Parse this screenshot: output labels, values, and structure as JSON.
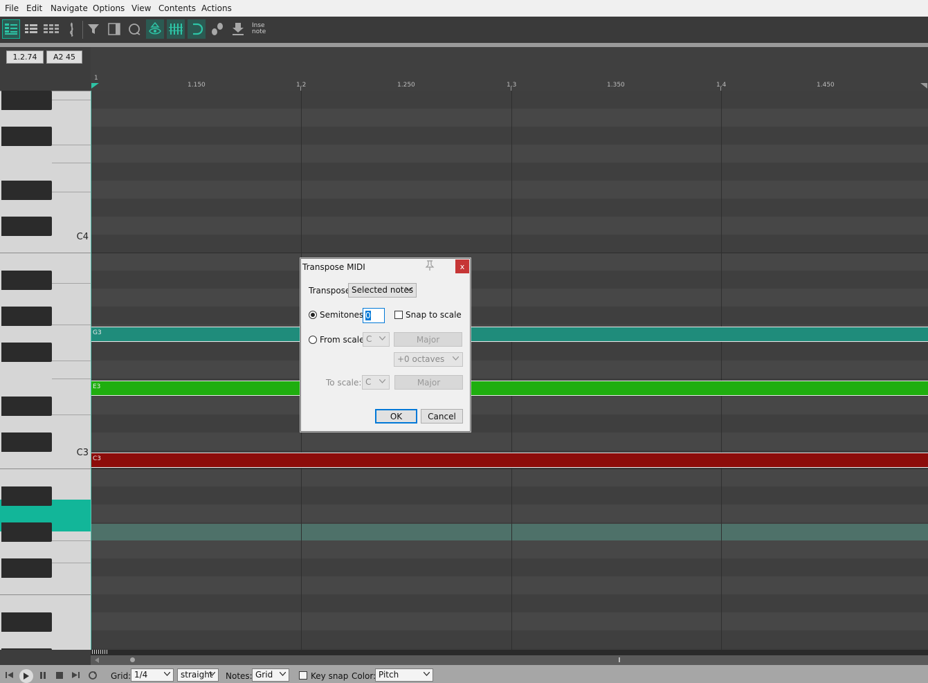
{
  "menu": [
    "File",
    "Edit",
    "Navigate",
    "Options",
    "View",
    "Contents",
    "Actions"
  ],
  "toolbar": {
    "insert_note_line1": "Inse",
    "insert_note_line2": "note"
  },
  "position_display": {
    "time": "1.2.74",
    "note": "A2  45"
  },
  "ruler": {
    "labels": [
      "1",
      "1.150",
      "1.2",
      "1.250",
      "1.3",
      "1.350",
      "1.4",
      "1.450"
    ]
  },
  "keyboard": {
    "labels": [
      "C4",
      "C3"
    ]
  },
  "notes": [
    {
      "label": "G3",
      "color": "#1f8c7b"
    },
    {
      "label": "E3",
      "color": "#1fae0f"
    },
    {
      "label": "C3",
      "color": "#8c0c0a"
    }
  ],
  "dialog": {
    "title": "Transpose MIDI",
    "transpose_label": "Transpose:",
    "transpose_value": "Selected notes",
    "semitones_label": "Semitones:",
    "semitones_value": "0",
    "snap_label": "Snap to scale",
    "from_scale_label": "From scale:",
    "from_key": "C",
    "from_mode": "Major",
    "octaves": "+0 octaves",
    "to_scale_label": "To scale:",
    "to_key": "C",
    "to_mode": "Major",
    "ok": "OK",
    "cancel": "Cancel"
  },
  "bottom": {
    "grid_label": "Grid:",
    "grid_value": "1/4",
    "grid_type": "straight",
    "notes_label": "Notes:",
    "notes_value": "Grid",
    "key_snap_label": "Key snap",
    "color_label": "Color:",
    "color_value": "Pitch"
  },
  "colors": {
    "accent": "#12b699",
    "selected_lane": "#4e7169"
  }
}
